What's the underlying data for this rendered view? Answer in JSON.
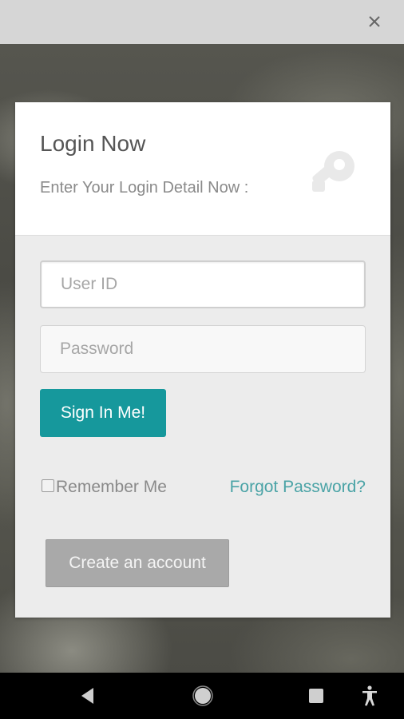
{
  "top_bar": {
    "close_icon": "close-icon"
  },
  "login": {
    "title": "Login Now",
    "subtitle": "Enter Your Login Detail Now :",
    "header_icon": "key-icon",
    "user_id_placeholder": "User ID",
    "user_id_value": "",
    "password_placeholder": "Password",
    "password_value": "",
    "sign_in_label": "Sign In Me!",
    "remember_me_label": "Remember Me",
    "remember_me_checked": false,
    "forgot_password_label": "Forgot Password?",
    "create_account_label": "Create an account"
  },
  "colors": {
    "accent": "#16989c",
    "link": "#4aa3a6",
    "secondary_button": "#a9a9a9"
  },
  "nav_bar": {
    "back_icon": "back-triangle-icon",
    "home_icon": "home-circle-icon",
    "recents_icon": "recents-square-icon",
    "accessibility_icon": "accessibility-icon"
  }
}
